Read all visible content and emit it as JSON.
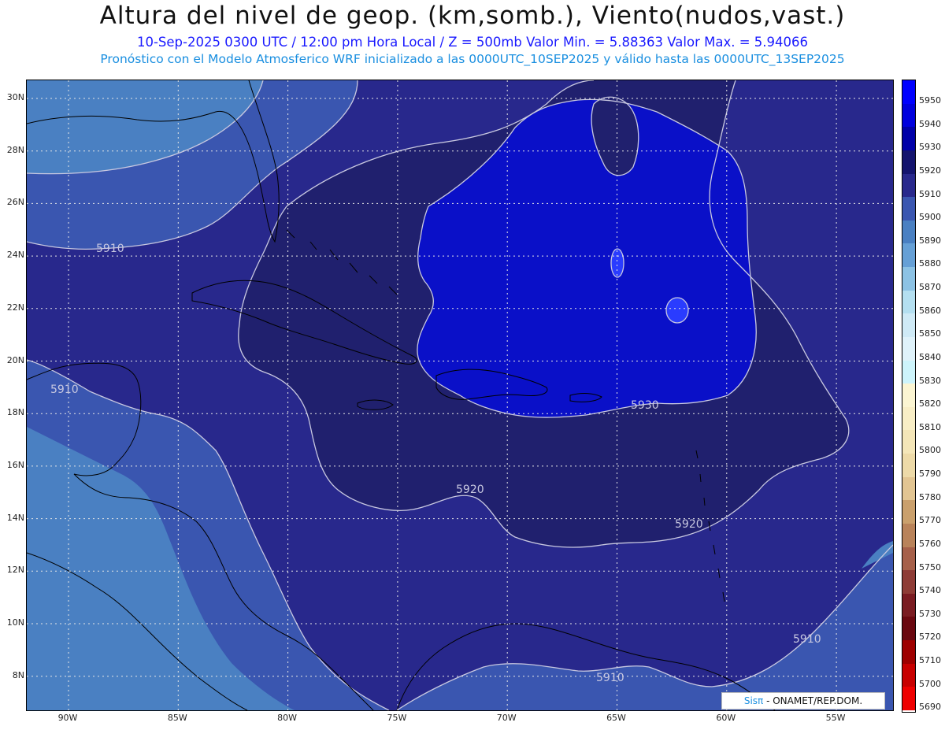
{
  "header": {
    "title": "Altura del nivel de geop. (km,somb.), Viento(nudos,vast.)",
    "subtitle": "10-Sep-2025  0300 UTC / 12:00 pm Hora Local / Z = 500mb     Valor Min. = 5.88363   Valor Max. = 5.94066",
    "model_line": "Pronóstico con el Modelo Atmosferico WRF inicializado a las 0000UTC_10SEP2025 y válido hasta las  0000UTC_13SEP2025"
  },
  "axes": {
    "lat_labels": [
      "30N",
      "28N",
      "26N",
      "24N",
      "22N",
      "20N",
      "18N",
      "16N",
      "14N",
      "12N",
      "10N",
      "8N"
    ],
    "lon_labels": [
      "90W",
      "85W",
      "80W",
      "75W",
      "70W",
      "65W",
      "60W",
      "55W"
    ]
  },
  "contour_labels": [
    "5910",
    "5910",
    "5930",
    "5920",
    "5920",
    "5910",
    "5910"
  ],
  "colorbar": {
    "levels": [
      "5950",
      "5940",
      "5930",
      "5920",
      "5910",
      "5900",
      "5890",
      "5880",
      "5870",
      "5860",
      "5850",
      "5840",
      "5830",
      "5820",
      "5810",
      "5800",
      "5790",
      "5780",
      "5770",
      "5760",
      "5750",
      "5740",
      "5730",
      "5720",
      "5710",
      "5700",
      "5690"
    ],
    "colors": [
      "#0000ff",
      "#0000dd",
      "#0000a8",
      "#14146e",
      "#28288c",
      "#3a56b0",
      "#4a80c2",
      "#66a0d6",
      "#8cc2e4",
      "#b4dff0",
      "#cfeaf6",
      "#dff2fa",
      "#cdf4fb",
      "#fbf5d2",
      "#f8eec6",
      "#f4e6b8",
      "#eddaa8",
      "#e2c592",
      "#caa06c",
      "#b9835a",
      "#a6604a",
      "#8e3c36",
      "#7a1c22",
      "#6a0810",
      "#9e0000",
      "#c80000",
      "#ee0000"
    ]
  },
  "credit": {
    "brand": "Sisπ",
    "org": " - ONAMET/REP.DOM."
  },
  "colors": {
    "domain_dark": "#20206e",
    "domain_mid": "#28288c",
    "high_center": "#0a10c8",
    "low_band": "#4a80c2",
    "contour": "#c8c8e0",
    "grid": "#e6e6e6"
  }
}
